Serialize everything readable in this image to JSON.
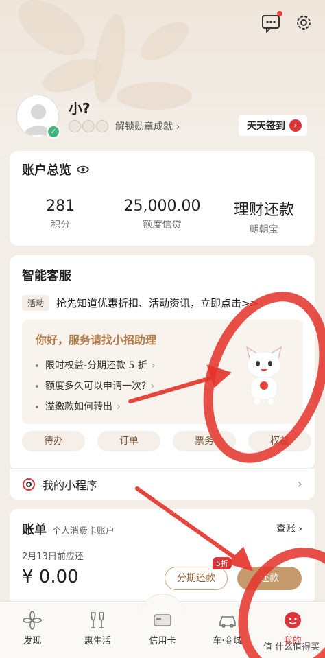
{
  "header": {
    "message_icon": "message-icon",
    "settings_icon": "gear-icon"
  },
  "profile": {
    "name": "小?",
    "badge_link": "解锁勋章成就 ›",
    "signin_label": "天天签到",
    "signin_arrow": "›"
  },
  "overview": {
    "title": "账户总览",
    "stats": [
      {
        "value": "281",
        "label": "积分"
      },
      {
        "value": "25,000.00",
        "label": "额度信贷"
      },
      {
        "value": "理财还款",
        "label": "朝朝宝"
      }
    ]
  },
  "service": {
    "title": "智能客服",
    "activity_tag": "活动",
    "activity_text": "抢先知道优惠折扣、活动资讯，立即点击>>",
    "assistant_title": "你好，服务请找小招助理",
    "questions": [
      "限时权益-分期还款 5 折",
      "额度多久可以申请一次?",
      "溢缴款如何转出"
    ],
    "chips": [
      "待办",
      "订单",
      "票务",
      "权益"
    ]
  },
  "mini_program": {
    "label": "我的小程序",
    "chevron": "›"
  },
  "bill": {
    "title": "账单",
    "subtitle": "个人消费卡账户",
    "link": "查账 ›",
    "due": "2月13日前应还",
    "amount": "¥ 0.00",
    "installment_button": "分期还款",
    "promo_badge": "5折",
    "pay_button": "还款"
  },
  "tabs": [
    {
      "label": "发现"
    },
    {
      "label": "惠生活"
    },
    {
      "label": "信用卡"
    },
    {
      "label": "车·商城"
    },
    {
      "label": "我的"
    }
  ],
  "watermark": "值 什么值得买",
  "colors": {
    "accent_red": "#d9373a",
    "gold": "#c49a6c",
    "annotation_red": "#e5332a"
  }
}
